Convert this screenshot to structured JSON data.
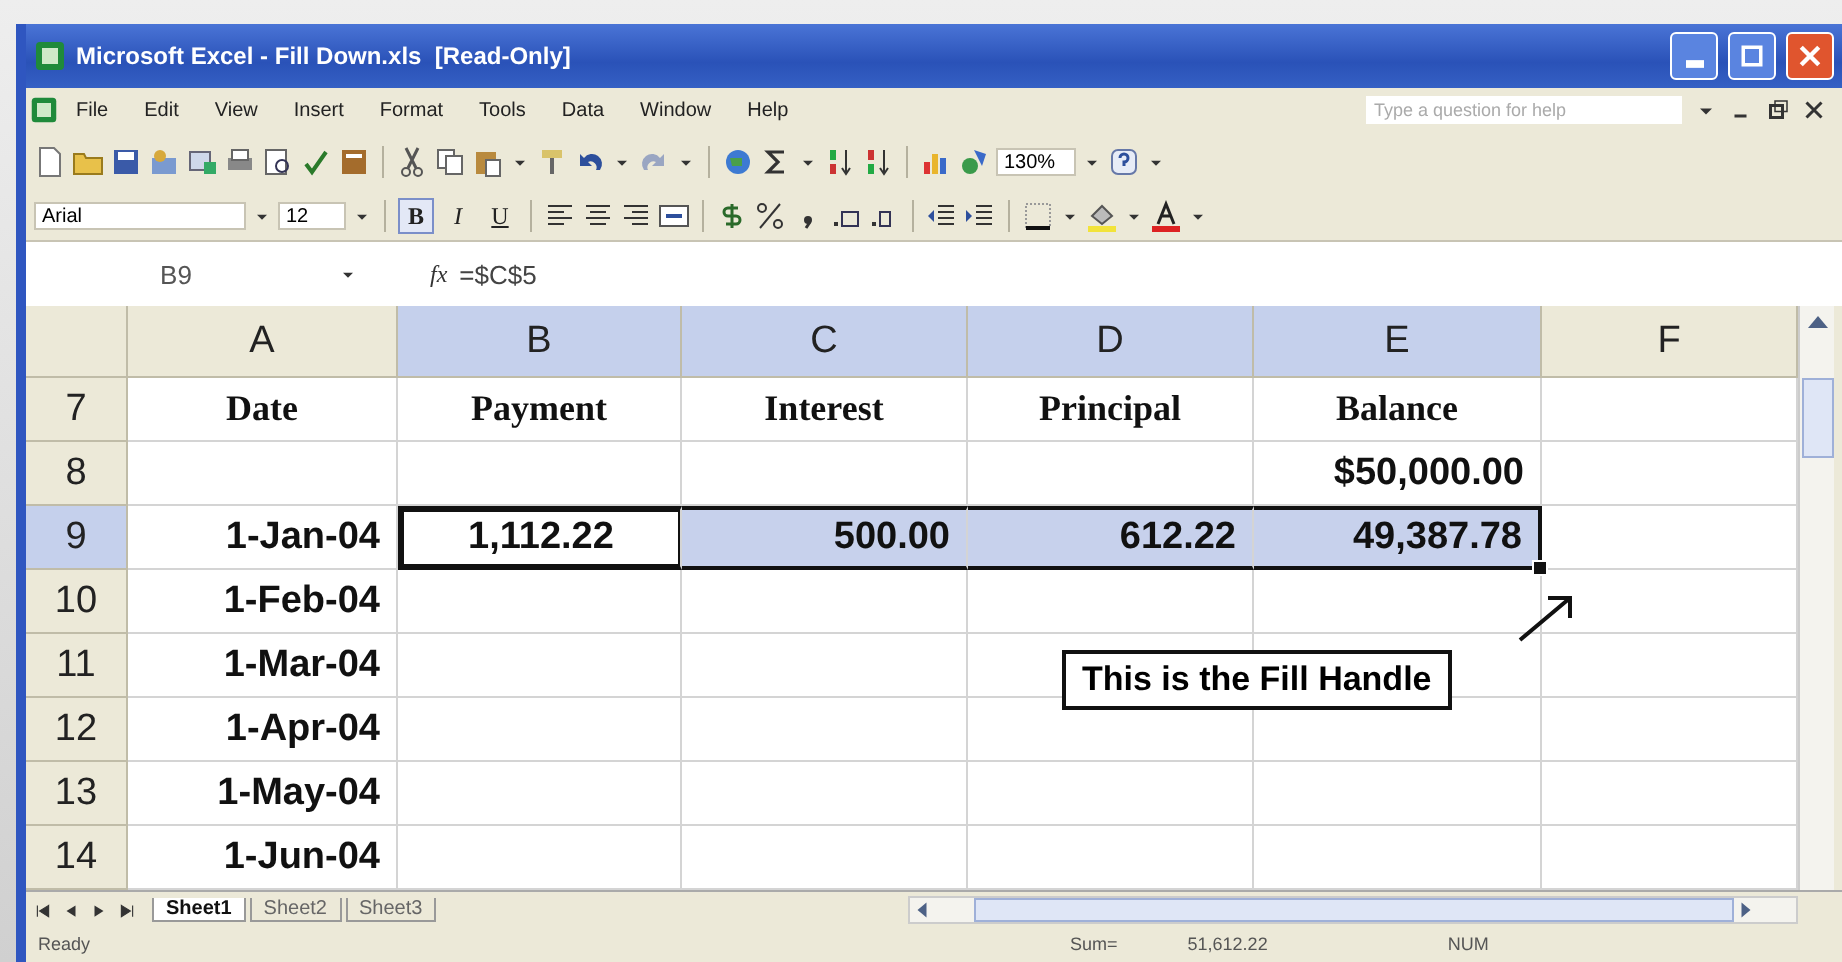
{
  "window": {
    "title": "Microsoft Excel - Fill Down.xls  [Read-Only]"
  },
  "menu": [
    {
      "label": "File"
    },
    {
      "label": "Edit"
    },
    {
      "label": "View"
    },
    {
      "label": "Insert"
    },
    {
      "label": "Format"
    },
    {
      "label": "Tools"
    },
    {
      "label": "Data"
    },
    {
      "label": "Window"
    },
    {
      "label": "Help"
    }
  ],
  "help_box": {
    "placeholder": "Type a question for help"
  },
  "standard_toolbar": {
    "zoom": "130%"
  },
  "formatting_toolbar": {
    "font": "Arial",
    "size": "12",
    "styles": [
      {
        "label": "B",
        "selected": true
      },
      {
        "label": "I",
        "selected": false
      },
      {
        "label": "U",
        "selected": false
      }
    ]
  },
  "formula_bar": {
    "name_box": "B9",
    "fx": "fx",
    "formula": "=$C$5"
  },
  "sheet": {
    "columns": [
      {
        "label": "A",
        "selected": false
      },
      {
        "label": "B",
        "selected": true
      },
      {
        "label": "C",
        "selected": true
      },
      {
        "label": "D",
        "selected": true
      },
      {
        "label": "E",
        "selected": true
      },
      {
        "label": "F",
        "selected": false
      }
    ],
    "rows": [
      {
        "label": "7",
        "kind": "heading",
        "selected": false,
        "cells": [
          {
            "text": "Date",
            "selected": false,
            "active": false
          },
          {
            "text": "Payment",
            "selected": false,
            "active": false
          },
          {
            "text": "Interest",
            "selected": false,
            "active": false
          },
          {
            "text": "Principal",
            "selected": false,
            "active": false
          },
          {
            "text": "Balance",
            "selected": false,
            "active": false
          },
          {
            "selected": false,
            "active": false
          }
        ]
      },
      {
        "label": "8",
        "kind": "value",
        "selected": false,
        "cells": [
          {
            "selected": false,
            "active": false
          },
          {
            "selected": false,
            "active": false
          },
          {
            "selected": false,
            "active": false
          },
          {
            "selected": false,
            "active": false
          },
          {
            "text": "$50,000.00",
            "selected": false,
            "active": false
          },
          {
            "selected": false,
            "active": false
          }
        ]
      },
      {
        "label": "9",
        "kind": "value",
        "selected": true,
        "cells": [
          {
            "text": "1-Jan-04",
            "selected": false,
            "active": false
          },
          {
            "text": "1,112.22",
            "selected": true,
            "active": true
          },
          {
            "text": "500.00",
            "selected": true,
            "active": false
          },
          {
            "text": "612.22",
            "selected": true,
            "active": false
          },
          {
            "text": "49,387.78",
            "selected": true,
            "active": false
          },
          {
            "selected": false,
            "active": false
          }
        ]
      },
      {
        "label": "10",
        "kind": "value",
        "selected": false,
        "cells": [
          {
            "text": "1-Feb-04",
            "selected": false,
            "active": false
          },
          {
            "selected": false,
            "active": false
          },
          {
            "selected": false,
            "active": false
          },
          {
            "selected": false,
            "active": false
          },
          {
            "selected": false,
            "active": false
          },
          {
            "selected": false,
            "active": false
          }
        ]
      },
      {
        "label": "11",
        "kind": "value",
        "selected": false,
        "cells": [
          {
            "text": "1-Mar-04",
            "selected": false,
            "active": false
          },
          {
            "selected": false,
            "active": false
          },
          {
            "selected": false,
            "active": false
          },
          {
            "selected": false,
            "active": false
          },
          {
            "selected": false,
            "active": false
          },
          {
            "selected": false,
            "active": false
          }
        ]
      },
      {
        "label": "12",
        "kind": "value",
        "selected": false,
        "cells": [
          {
            "text": "1-Apr-04",
            "selected": false,
            "active": false
          },
          {
            "selected": false,
            "active": false
          },
          {
            "selected": false,
            "active": false
          },
          {
            "selected": false,
            "active": false
          },
          {
            "selected": false,
            "active": false
          },
          {
            "selected": false,
            "active": false
          }
        ]
      },
      {
        "label": "13",
        "kind": "value",
        "selected": false,
        "cells": [
          {
            "text": "1-May-04",
            "selected": false,
            "active": false
          },
          {
            "selected": false,
            "active": false
          },
          {
            "selected": false,
            "active": false
          },
          {
            "selected": false,
            "active": false
          },
          {
            "selected": false,
            "active": false
          },
          {
            "selected": false,
            "active": false
          }
        ]
      },
      {
        "label": "14",
        "kind": "value",
        "selected": false,
        "cells": [
          {
            "text": "1-Jun-04",
            "selected": false,
            "active": false
          },
          {
            "selected": false,
            "active": false
          },
          {
            "selected": false,
            "active": false
          },
          {
            "selected": false,
            "active": false
          },
          {
            "selected": false,
            "active": false
          },
          {
            "selected": false,
            "active": false
          }
        ]
      }
    ]
  },
  "callout": {
    "text": "This is the Fill Handle"
  },
  "sheet_tabs": [
    {
      "label": "Sheet1",
      "selected": true
    },
    {
      "label": "Sheet2",
      "selected": false
    },
    {
      "label": "Sheet3",
      "selected": false
    }
  ],
  "status_bar": {
    "state": "Ready",
    "sum_label": "Sum=",
    "sum": "51,612.22",
    "mode": "NUM"
  }
}
